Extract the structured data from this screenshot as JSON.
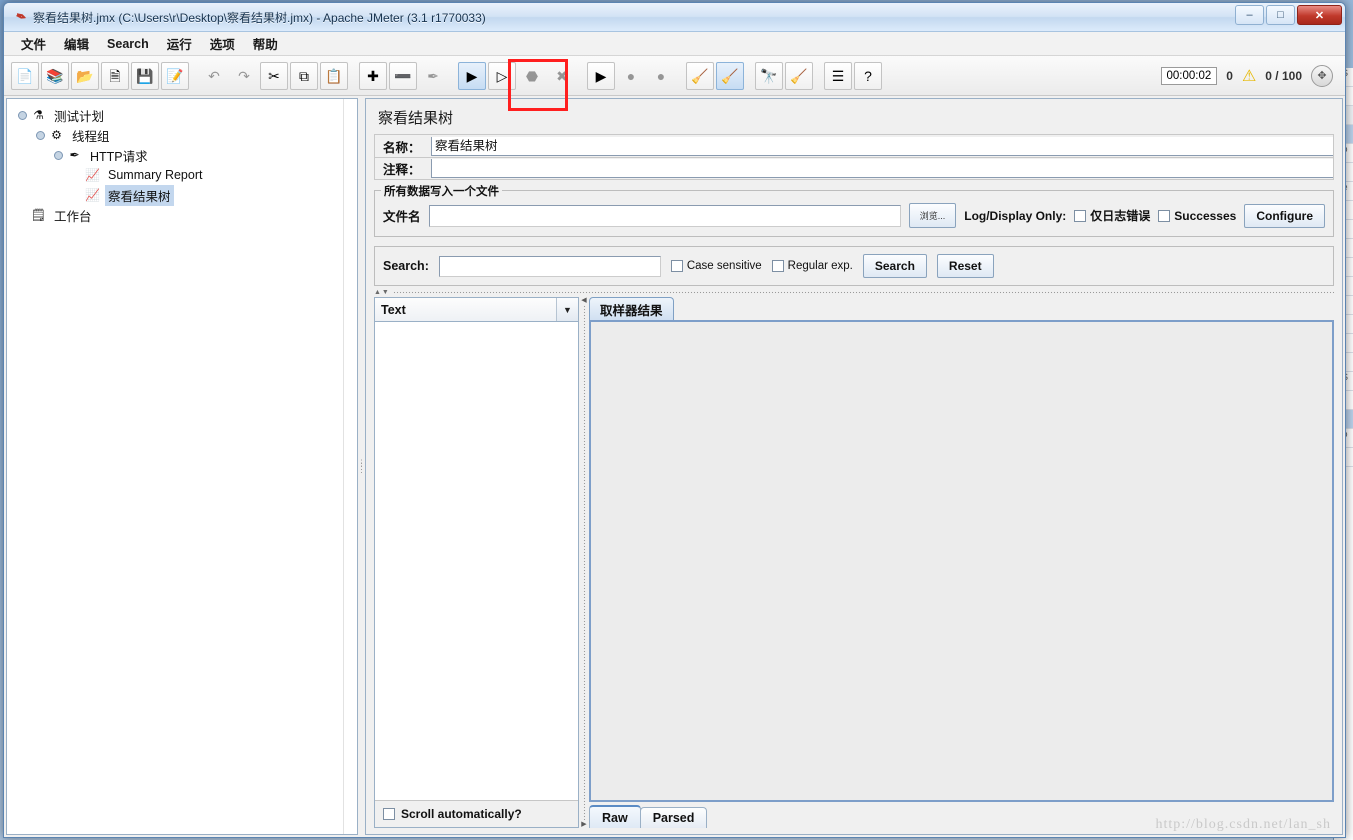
{
  "window": {
    "title": "察看结果树.jmx (C:\\Users\\r\\Desktop\\察看结果树.jmx) - Apache JMeter (3.1 r1770033)",
    "app_icon": "jmeter-feather-icon",
    "controls": {
      "minimize": "–",
      "maximize": "□",
      "close": "✕"
    }
  },
  "menubar": {
    "items": [
      {
        "label": "文件",
        "name": "menu-file"
      },
      {
        "label": "编辑",
        "name": "menu-edit"
      },
      {
        "label": "Search",
        "name": "menu-search"
      },
      {
        "label": "运行",
        "name": "menu-run"
      },
      {
        "label": "选项",
        "name": "menu-options"
      },
      {
        "label": "帮助",
        "name": "menu-help"
      }
    ]
  },
  "toolbar": {
    "buttons": [
      {
        "name": "new-button",
        "icon": "📄",
        "state": "enabled",
        "group": 0
      },
      {
        "name": "templates-button",
        "icon": "📚",
        "state": "enabled",
        "group": 0
      },
      {
        "name": "open-button",
        "icon": "📂",
        "state": "enabled",
        "group": 0
      },
      {
        "name": "close-button",
        "icon": "🗎",
        "state": "enabled",
        "group": 0
      },
      {
        "name": "save-button",
        "icon": "💾",
        "state": "enabled",
        "group": 0
      },
      {
        "name": "save-as-button",
        "icon": "📝",
        "state": "enabled",
        "group": 0
      },
      {
        "name": "undo-button",
        "icon": "↶",
        "state": "disabled",
        "group": 1
      },
      {
        "name": "redo-button",
        "icon": "↷",
        "state": "disabled",
        "group": 1
      },
      {
        "name": "cut-button",
        "icon": "✂",
        "state": "enabled",
        "group": 1
      },
      {
        "name": "copy-button",
        "icon": "⧉",
        "state": "enabled",
        "group": 1
      },
      {
        "name": "paste-button",
        "icon": "📋",
        "state": "enabled",
        "group": 1
      },
      {
        "name": "expand-all-button",
        "icon": "✚",
        "state": "enabled",
        "group": 2
      },
      {
        "name": "collapse-all-button",
        "icon": "➖",
        "state": "enabled",
        "group": 2
      },
      {
        "name": "toggle-button",
        "icon": "✒",
        "state": "disabled",
        "group": 2
      },
      {
        "name": "start-button",
        "icon": "▶",
        "state": "active",
        "group": 3
      },
      {
        "name": "start-no-pauses-button",
        "icon": "▷",
        "state": "enabled",
        "group": 3
      },
      {
        "name": "stop-button",
        "icon": "⬣",
        "state": "disabled",
        "group": 3
      },
      {
        "name": "shutdown-button",
        "icon": "✖",
        "state": "disabled",
        "group": 3
      },
      {
        "name": "remote-start-all-button",
        "icon": "▶",
        "state": "enabled",
        "group": 4
      },
      {
        "name": "remote-stop-all-button",
        "icon": "●",
        "state": "disabled",
        "group": 4
      },
      {
        "name": "remote-shutdown-all-button",
        "icon": "●",
        "state": "disabled",
        "group": 4
      },
      {
        "name": "clear-button",
        "icon": "🧹",
        "state": "enabled",
        "group": 5
      },
      {
        "name": "clear-all-button",
        "icon": "🧹",
        "state": "active",
        "group": 5
      },
      {
        "name": "search-button",
        "icon": "🔭",
        "state": "enabled",
        "group": 6
      },
      {
        "name": "search-reset-button",
        "icon": "🧹",
        "state": "enabled",
        "group": 6
      },
      {
        "name": "function-helper-button",
        "icon": "☰",
        "state": "enabled",
        "group": 7
      },
      {
        "name": "help-button",
        "icon": "?",
        "state": "enabled",
        "group": 7
      }
    ],
    "status": {
      "elapsed": "00:00:02",
      "errors": "0",
      "warn_icon": "warning-triangle-icon",
      "threads": "0 / 100",
      "fit_icon": "expand-icon"
    },
    "highlight": {
      "target": "start-button",
      "color": "#ff1f1f"
    }
  },
  "tree": {
    "nodes": [
      {
        "label": "测试计划",
        "icon": "test-plan-icon",
        "depth": 0,
        "knob": true,
        "selected": false
      },
      {
        "label": "线程组",
        "icon": "thread-group-icon",
        "depth": 1,
        "knob": true,
        "selected": false
      },
      {
        "label": "HTTP请求",
        "icon": "http-request-icon",
        "depth": 2,
        "knob": true,
        "selected": false
      },
      {
        "label": "Summary Report",
        "icon": "listener-icon",
        "depth": 3,
        "knob": false,
        "selected": false
      },
      {
        "label": "察看结果树",
        "icon": "listener-icon",
        "depth": 3,
        "knob": false,
        "selected": true
      },
      {
        "label": "工作台",
        "icon": "workbench-icon",
        "depth": 0,
        "knob": false,
        "selected": false
      }
    ]
  },
  "panel": {
    "title": "察看结果树",
    "name_label": "名称：",
    "name_value": "察看结果树",
    "comment_label": "注释：",
    "comment_value": "",
    "file_group": {
      "legend": "所有数据写入一个文件",
      "filename_label": "文件名",
      "filename_value": "",
      "browse_label": "浏览...",
      "log_display_label": "Log/Display Only:",
      "errors_only_label": "仅日志错误",
      "errors_only_checked": false,
      "successes_label": "Successes",
      "successes_checked": false,
      "configure_label": "Configure"
    },
    "search_bar": {
      "label": "Search:",
      "value": "",
      "case_sensitive_label": "Case sensitive",
      "case_sensitive_checked": false,
      "regular_exp_label": "Regular exp.",
      "regular_exp_checked": false,
      "search_button": "Search",
      "reset_button": "Reset"
    },
    "renderer": {
      "selected": "Text",
      "arrow_icon": "chevron-down-icon",
      "scroll_auto_label": "Scroll automatically?",
      "scroll_auto_checked": false
    },
    "result_tabs": [
      {
        "label": "取样器结果",
        "active": true
      }
    ],
    "raw_tabs": [
      {
        "label": "Raw",
        "active": true
      },
      {
        "label": "Parsed",
        "active": false
      }
    ],
    "result_content": ""
  },
  "watermark": "http://blog.csdn.net/lan_sh",
  "background_window": {
    "rows": [
      {
        "text": "ES",
        "kind": "plain"
      },
      {
        "text": "In",
        "kind": "plain"
      },
      {
        "text": "O",
        "kind": "hdr"
      },
      {
        "text": "",
        "kind": "sel"
      },
      {
        "text": "Co",
        "kind": "plain"
      },
      {
        "text": "",
        "kind": "plain"
      },
      {
        "text": "Re",
        "kind": "plain"
      },
      {
        "text": "",
        "kind": "plain"
      },
      {
        "text": "",
        "kind": "plain"
      },
      {
        "text": "",
        "kind": "plain"
      },
      {
        "text": "",
        "kind": "plain"
      },
      {
        "text": "",
        "kind": "plain"
      },
      {
        "text": "",
        "kind": "plain"
      },
      {
        "text": "",
        "kind": "plain"
      },
      {
        "text": "",
        "kind": "plain"
      },
      {
        "text": "",
        "kind": "plain"
      },
      {
        "text": "ES",
        "kind": "plain"
      },
      {
        "text": "In",
        "kind": "plain"
      },
      {
        "text": "",
        "kind": "sel"
      },
      {
        "text": "Co",
        "kind": "plain"
      },
      {
        "text": "",
        "kind": "plain"
      }
    ]
  },
  "colors": {
    "accent": "#5b8bc4",
    "highlight_red": "#ff1f1f",
    "tree_selection": "#c3d7ee",
    "panel_bg": "#f0f0f0"
  }
}
